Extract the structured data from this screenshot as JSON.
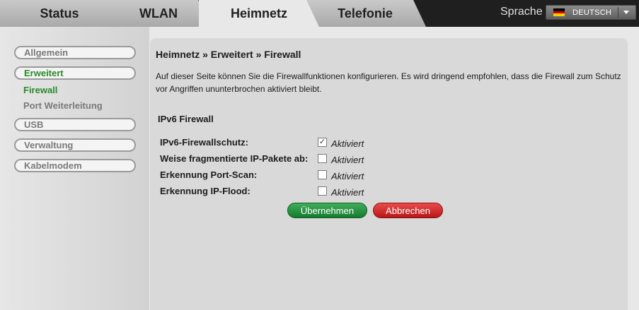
{
  "tabs": [
    {
      "label": "Status"
    },
    {
      "label": "WLAN"
    },
    {
      "label": "Heimnetz",
      "active": true
    },
    {
      "label": "Telefonie"
    }
  ],
  "language": {
    "label": "Sprache",
    "selected": "DEUTSCH",
    "flag_colors": [
      "#000000",
      "#dd0000",
      "#ffce00"
    ]
  },
  "sidebar": {
    "items": [
      {
        "label": "Allgemein"
      },
      {
        "label": "Erweitert"
      },
      {
        "label": "USB"
      },
      {
        "label": "Verwaltung"
      },
      {
        "label": "Kabelmodem"
      }
    ],
    "subitems": [
      {
        "label": "Firewall",
        "active": true
      },
      {
        "label": "Port Weiterleitung"
      }
    ]
  },
  "main": {
    "breadcrumb": "Heimnetz » Erweitert » Firewall",
    "description": "Auf dieser Seite können Sie die Firewallfunktionen konfigurieren. Es wird dringend empfohlen, dass die Firewall zum Schutz vor Angriffen ununterbrochen aktiviert bleibt.",
    "section_title": "IPv6 Firewall",
    "rows": [
      {
        "label": "IPv6-Firewallschutz:",
        "checked": true,
        "option": "Aktiviert"
      },
      {
        "label": "Weise fragmentierte IP-Pakete ab:",
        "checked": false,
        "option": "Aktiviert"
      },
      {
        "label": "Erkennung Port-Scan:",
        "checked": false,
        "option": "Aktiviert"
      },
      {
        "label": "Erkennung IP-Flood:",
        "checked": false,
        "option": "Aktiviert"
      }
    ],
    "apply_label": "Übernehmen",
    "cancel_label": "Abbrechen"
  },
  "colors": {
    "accent_green": "#2a8a2a",
    "apply_button": "#177a2e",
    "cancel_button": "#b51717"
  }
}
